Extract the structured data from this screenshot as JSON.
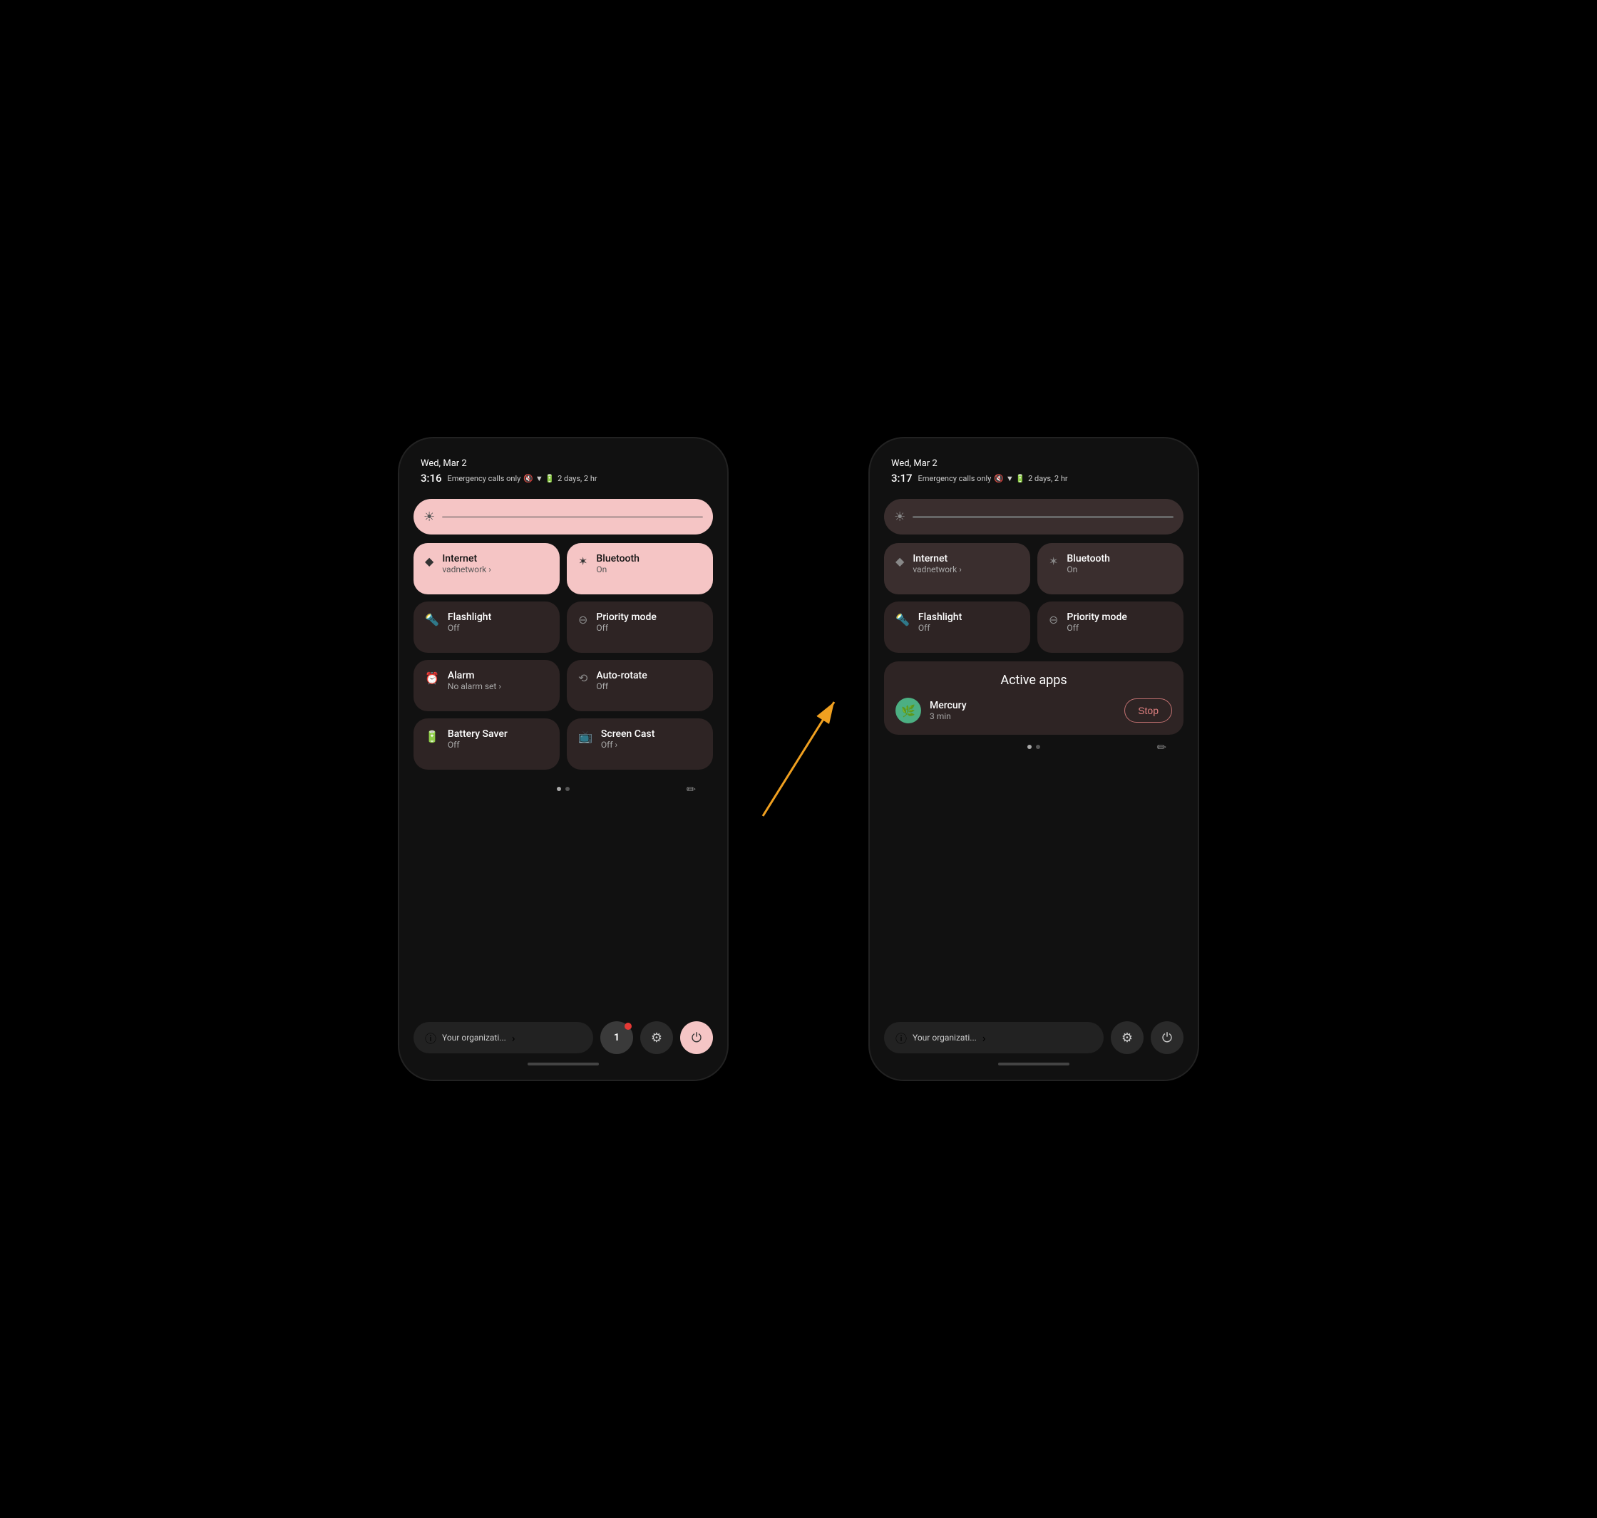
{
  "left_phone": {
    "date": "Wed, Mar 2",
    "time": "3:16",
    "status": "Emergency calls only",
    "battery": "2 days, 2 hr",
    "brightness_icon": "☀",
    "tiles": [
      {
        "id": "internet",
        "icon": "◆",
        "title": "Internet",
        "sub": "vadnetwork",
        "chevron": true,
        "active": true
      },
      {
        "id": "bluetooth",
        "icon": "✶",
        "title": "Bluetooth",
        "sub": "On",
        "chevron": false,
        "active": true
      },
      {
        "id": "flashlight",
        "icon": "🔦",
        "title": "Flashlight",
        "sub": "Off",
        "chevron": false,
        "active": false
      },
      {
        "id": "priority",
        "icon": "⊖",
        "title": "Priority mode",
        "sub": "Off",
        "chevron": false,
        "active": false
      },
      {
        "id": "alarm",
        "icon": "⏰",
        "title": "Alarm",
        "sub": "No alarm set",
        "chevron": true,
        "active": false
      },
      {
        "id": "autorotate",
        "icon": "⟲",
        "title": "Auto-rotate",
        "sub": "Off",
        "chevron": false,
        "active": false
      },
      {
        "id": "battery",
        "icon": "🔋",
        "title": "Battery Saver",
        "sub": "Off",
        "chevron": false,
        "active": false
      },
      {
        "id": "screencast",
        "icon": "📺",
        "title": "Screen Cast",
        "sub": "Off",
        "chevron": true,
        "active": false
      }
    ],
    "pagination": [
      true,
      false
    ],
    "edit_icon": "✏",
    "bottom": {
      "org_text": "Your organizati...",
      "chevron": ">",
      "notifications": "1",
      "settings_icon": "⚙",
      "power_icon": "⏻"
    }
  },
  "right_phone": {
    "date": "Wed, Mar 2",
    "time": "3:17",
    "status": "Emergency calls only",
    "battery": "2 days, 2 hr",
    "brightness_icon": "☀",
    "tiles": [
      {
        "id": "internet",
        "icon": "◆",
        "title": "Internet",
        "sub": "vadnetwork",
        "chevron": true,
        "active": true
      },
      {
        "id": "bluetooth",
        "icon": "✶",
        "title": "Bluetooth",
        "sub": "On",
        "chevron": false,
        "active": true
      },
      {
        "id": "flashlight",
        "icon": "🔦",
        "title": "Flashlight",
        "sub": "Off",
        "chevron": false,
        "active": false
      },
      {
        "id": "priority",
        "icon": "⊖",
        "title": "Priority mode",
        "sub": "Off",
        "chevron": false,
        "active": false
      }
    ],
    "active_apps_title": "Active apps",
    "active_app": {
      "name": "Mercury",
      "duration": "3 min",
      "stop_label": "Stop",
      "icon_color": "#4caf82"
    },
    "pagination": [
      true,
      false
    ],
    "edit_icon": "✏",
    "bottom": {
      "org_text": "Your organizati...",
      "chevron": ">",
      "settings_icon": "⚙",
      "power_icon": "⏻"
    }
  },
  "arrow": {
    "color": "#f0a020",
    "label": ""
  }
}
